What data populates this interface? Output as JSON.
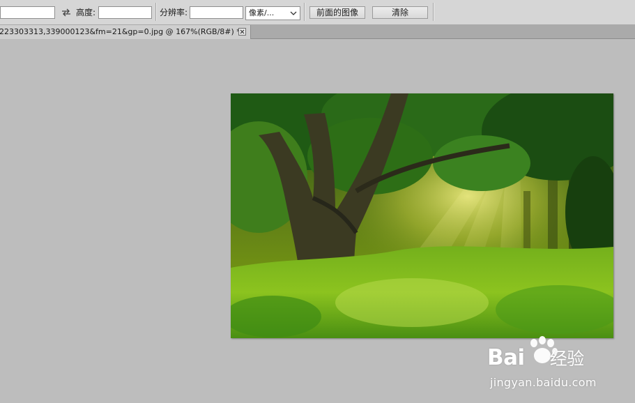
{
  "options_bar": {
    "width_value": "",
    "swap_icon": "swap-arrows-icon",
    "height_label": "高度:",
    "height_value": "",
    "resolution_label": "分辨率:",
    "resolution_value": "",
    "unit_select_value": "像素/...",
    "front_image_button": "前面的图像",
    "clear_button": "清除"
  },
  "document_tab": {
    "title": "223303313,339000123&fm=21&gp=0.jpg @ 167%(RGB/8#) *",
    "close_icon": "close-x-icon"
  },
  "canvas": {
    "image_description_icon": "forest-photo",
    "watermark_brand": "Bai",
    "watermark_brand_cn": "经验",
    "watermark_url": "jingyan.baidu.com"
  }
}
